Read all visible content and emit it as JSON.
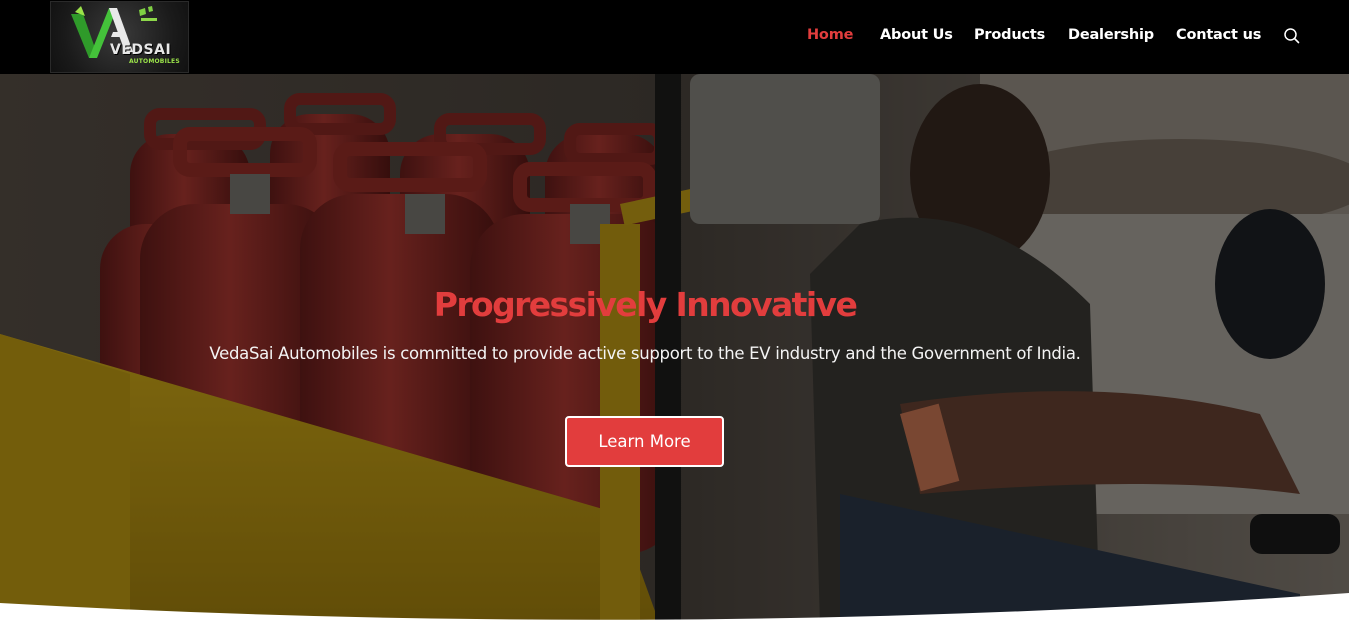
{
  "brand": {
    "logo_text": "VEDSAI",
    "logo_sub": "AUTOMOBILES"
  },
  "nav": {
    "items": [
      {
        "label": "Home",
        "active": true
      },
      {
        "label": "About Us",
        "active": false
      },
      {
        "label": "Products",
        "active": false
      },
      {
        "label": "Dealership",
        "active": false
      },
      {
        "label": "Contact us",
        "active": false
      }
    ],
    "search_icon": "search-icon"
  },
  "hero": {
    "title": "Progressively Innovative",
    "subtitle": "VedaSai Automobiles is committed to provide active support to the EV industry and the Government of India.",
    "cta_label": "Learn More"
  },
  "colors": {
    "accent": "#e23d3d",
    "header_bg": "#000000",
    "nav_text": "#ffffff"
  }
}
